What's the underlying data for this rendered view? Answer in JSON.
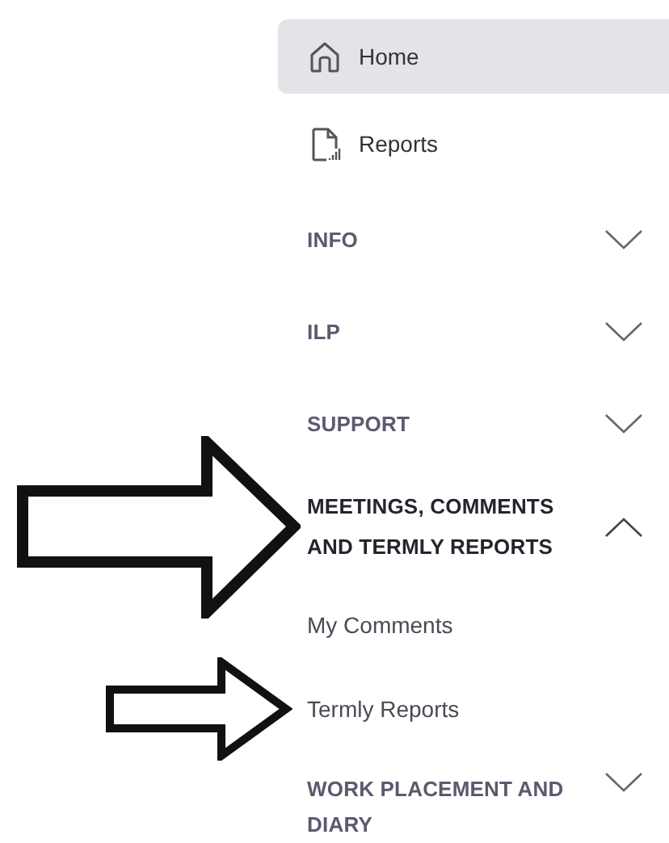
{
  "nav": [
    {
      "kind": "link",
      "label": "Home",
      "selected": true,
      "pointed": false
    },
    {
      "kind": "link",
      "label": "Reports",
      "selected": false,
      "pointed": false
    },
    {
      "kind": "section",
      "label": "INFO",
      "expanded": false,
      "pointed": false
    },
    {
      "kind": "section",
      "label": "ILP",
      "expanded": false,
      "pointed": false
    },
    {
      "kind": "section",
      "label": "SUPPORT",
      "expanded": false,
      "pointed": false
    },
    {
      "kind": "section",
      "label": "MEETINGS, COMMENTS AND TERMLY REPORTS",
      "expanded": true,
      "pointed": true
    },
    {
      "kind": "subitem",
      "label": "My Comments",
      "pointed": false
    },
    {
      "kind": "subitem",
      "label": "Termly Reports",
      "pointed": true
    },
    {
      "kind": "section",
      "label": "WORK PLACEMENT AND DIARY",
      "expanded": false,
      "pointed": false
    }
  ]
}
